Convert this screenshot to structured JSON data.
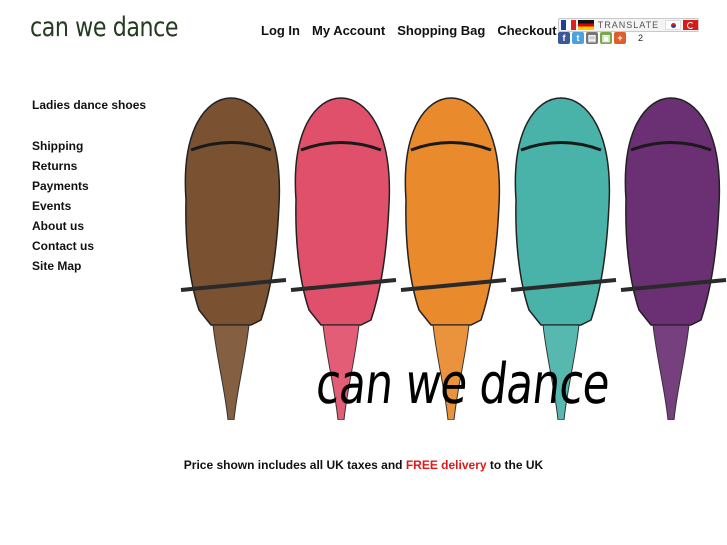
{
  "brand": {
    "logo_text": "can we dance"
  },
  "topnav": {
    "items": [
      {
        "label": "Log In"
      },
      {
        "label": "My Account"
      },
      {
        "label": "Shopping Bag"
      },
      {
        "label": "Checkout"
      }
    ]
  },
  "translate": {
    "label": "TRANSLATE",
    "languages": [
      "french-flag",
      "german-flag",
      "korean-flag",
      "turkish-flag"
    ]
  },
  "share": {
    "icons": [
      "facebook-icon",
      "twitter-icon",
      "print-icon",
      "share-icon",
      "plus-icon"
    ],
    "count": "2"
  },
  "sidenav": {
    "category": "Ladies dance shoes",
    "items": [
      {
        "label": "Shipping"
      },
      {
        "label": "Returns"
      },
      {
        "label": "Payments"
      },
      {
        "label": "Events"
      },
      {
        "label": "About us"
      },
      {
        "label": "Contact us"
      },
      {
        "label": "Site Map"
      }
    ]
  },
  "hero": {
    "logo_text": "can we dance",
    "shoe_colors": [
      "#7a5232",
      "#e0506a",
      "#e98a2c",
      "#49b3aa",
      "#6b2f73"
    ]
  },
  "footer_note": {
    "prefix": "Price shown includes all UK taxes and ",
    "highlight": "FREE delivery",
    "suffix": " to the UK",
    "highlight_color": "#e01818"
  }
}
